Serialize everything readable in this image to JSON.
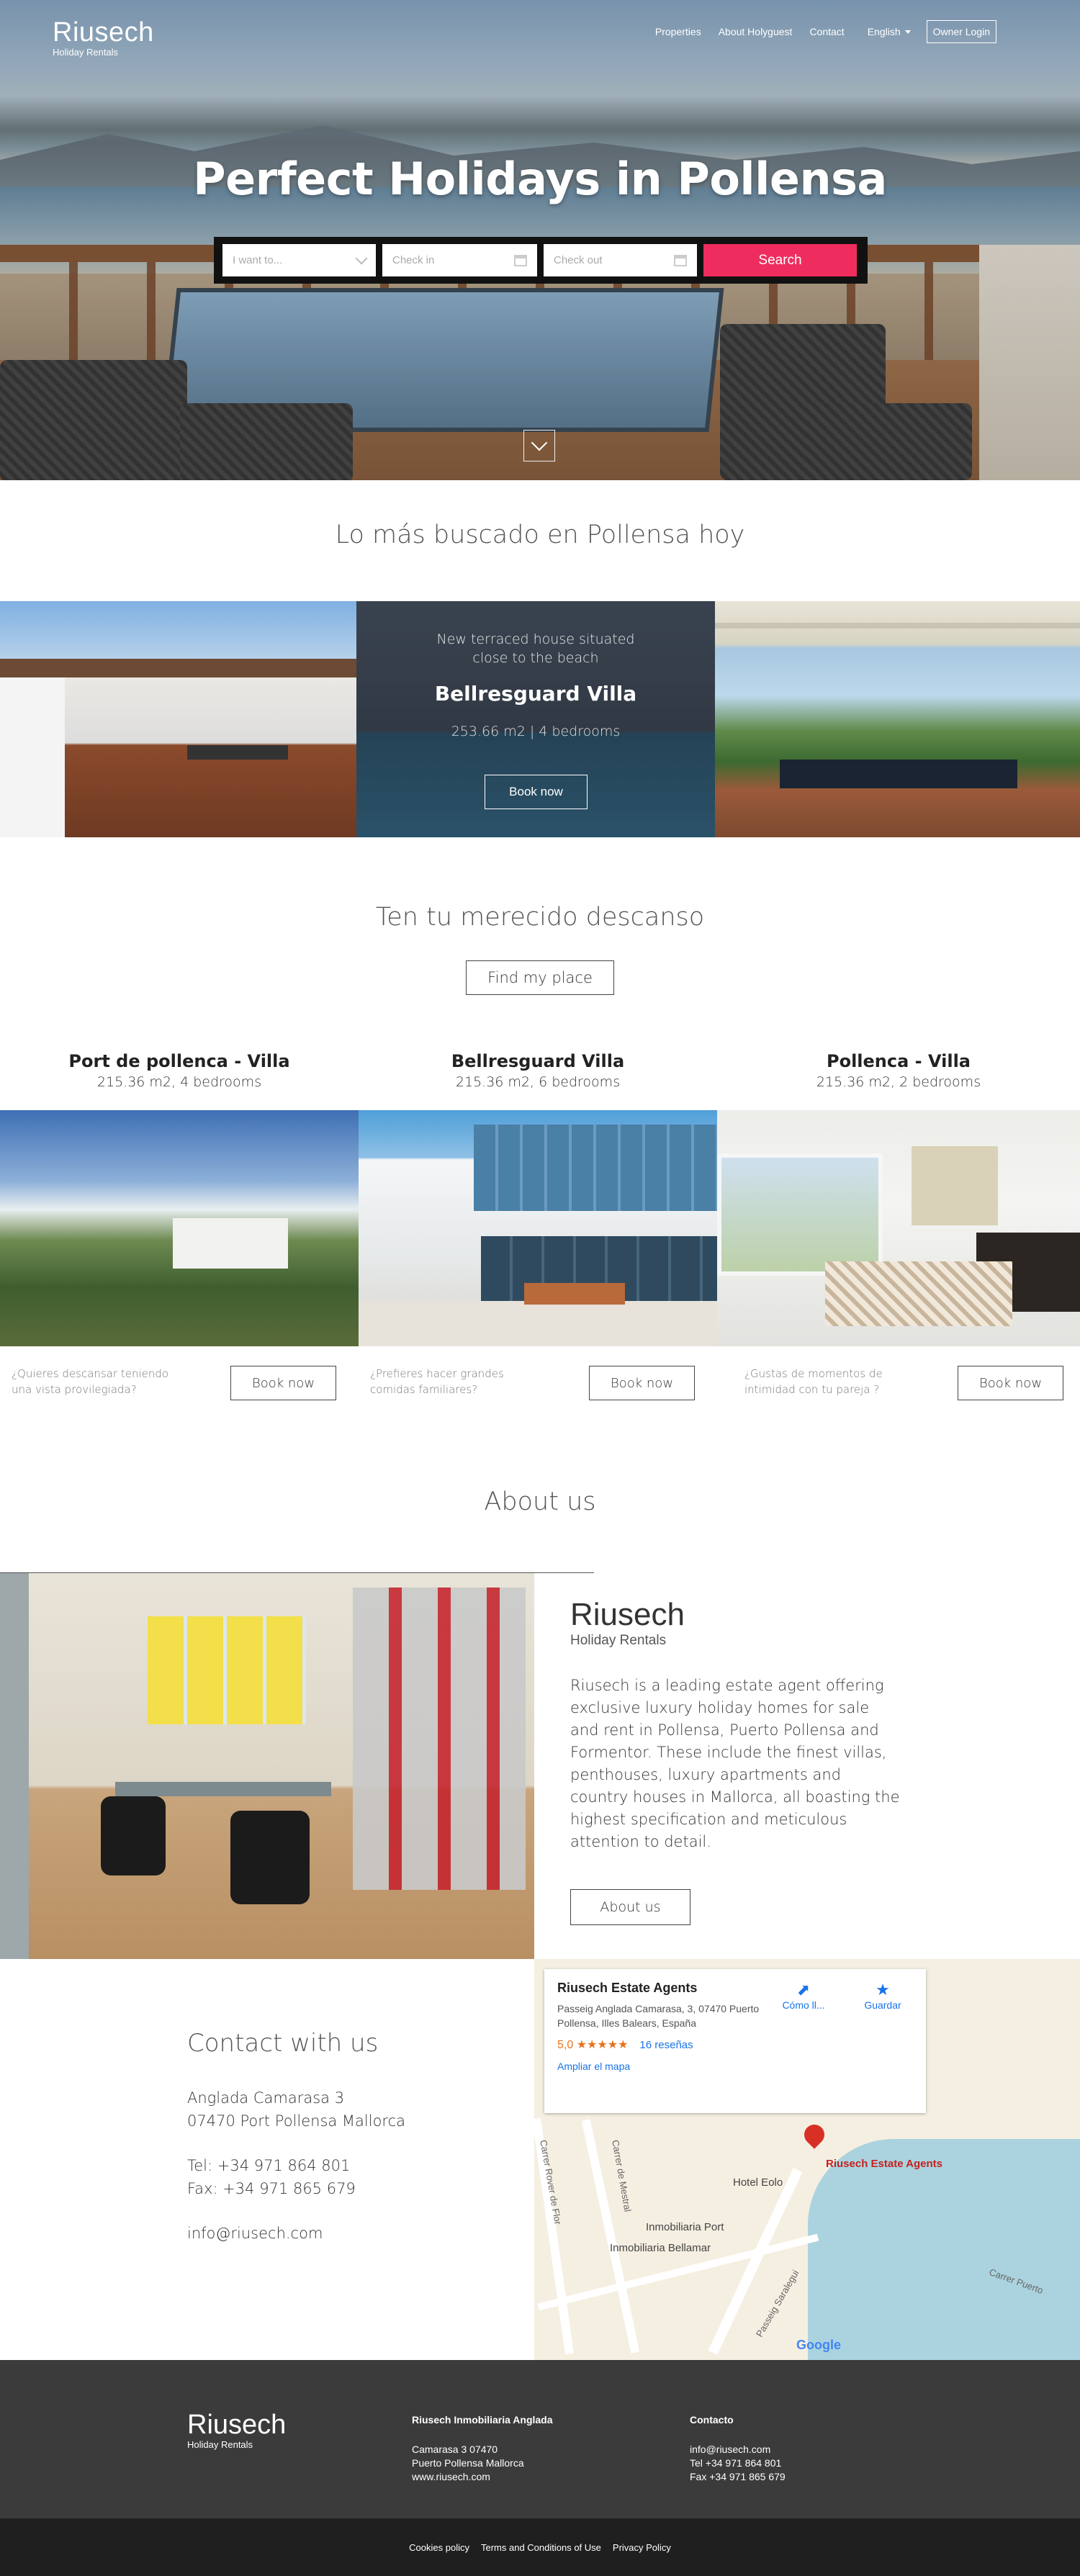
{
  "header": {
    "logo": "Riusech",
    "logo_sub": "Holiday Rentals",
    "nav": [
      "Properties",
      "About Holyguest",
      "Contact"
    ],
    "language": "English",
    "owner_login": "Owner Login"
  },
  "hero": {
    "title": "Perfect Holidays in Pollensa",
    "search": {
      "want_placeholder": "I want to...",
      "checkin_placeholder": "Check in",
      "checkout_placeholder": "Check out",
      "button": "Search"
    }
  },
  "popular": {
    "title": "Lo más buscado en Pollensa hoy",
    "featured": {
      "subtitle": "New terraced house situated close to the beach",
      "name": "Bellresguard Villa",
      "details": "253.66 m2 | 4 bedrooms",
      "button": "Book now"
    }
  },
  "rest": {
    "title": "Ten tu merecido descanso",
    "button": "Find my place",
    "properties": [
      {
        "name": "Port de pollenca - Villa",
        "details": "215.36 m2, 4 bedrooms",
        "question": "¿Quieres descansar teniendo una vista provilegiada?",
        "button": "Book now"
      },
      {
        "name": "Bellresguard Villa",
        "details": "215.36 m2, 6 bedrooms",
        "question": "¿Prefieres hacer grandes comidas familiares?",
        "button": "Book now"
      },
      {
        "name": "Pollenca - Villa",
        "details": "215.36 m2, 2 bedrooms",
        "question": "¿Gustas de momentos de intimidad con tu pareja ?",
        "button": "Book now"
      }
    ]
  },
  "about": {
    "title": "About us",
    "logo": "Riusech",
    "logo_sub": "Holiday Rentals",
    "text": "Riusech is a leading estate agent offering exclusive luxury holiday homes for sale and rent in Pollensa, Puerto Pollensa and Formentor. These include the finest villas, penthouses, luxury apartments and country houses in Mallorca, all boasting the highest specification and meticulous attention to detail.",
    "button": "About us"
  },
  "contact": {
    "title": "Contact with us",
    "address1": "Anglada Camarasa 3",
    "address2": "07470 Port Pollensa  Mallorca",
    "tel": "Tel: +34 971 864 801",
    "fax": "Fax: +34 971 865 679",
    "email": "info@riusech.com"
  },
  "map": {
    "name": "Riusech Estate Agents",
    "address": "Passeig Anglada Camarasa, 3, 07470 Puerto Pollensa, Illes Balears, España",
    "rating": "5,0 ★★★★★",
    "reviews": "16 reseñas",
    "enlarge": "Ampliar el mapa",
    "directions": "Cómo ll...",
    "save": "Guardar",
    "pin_label": "Riusech Estate Agents",
    "labels": [
      "Hotel Eolo",
      "Inmobiliaria Port",
      "Inmobiliaria Bellamar",
      "Carrer de Mestral",
      "Carrer Rover de Flor",
      "Passeig Saralegui",
      "Carrer Puerto"
    ],
    "google": "Google"
  },
  "footer": {
    "logo": "Riusech",
    "logo_sub": "Holiday Rentals",
    "col1_title": "Riusech Inmobiliaria Anglada",
    "col1_lines": [
      "Camarasa 3  07470",
      "Puerto Pollensa  Mallorca",
      "www.riusech.com"
    ],
    "col2_title": "Contacto",
    "col2_lines": [
      "info@riusech.com",
      "Tel +34 971 864 801",
      "Fax +34 971 865 679"
    ],
    "links": [
      "Cookies policy",
      "Terms and Conditions of Use",
      "Privacy Policy"
    ]
  }
}
